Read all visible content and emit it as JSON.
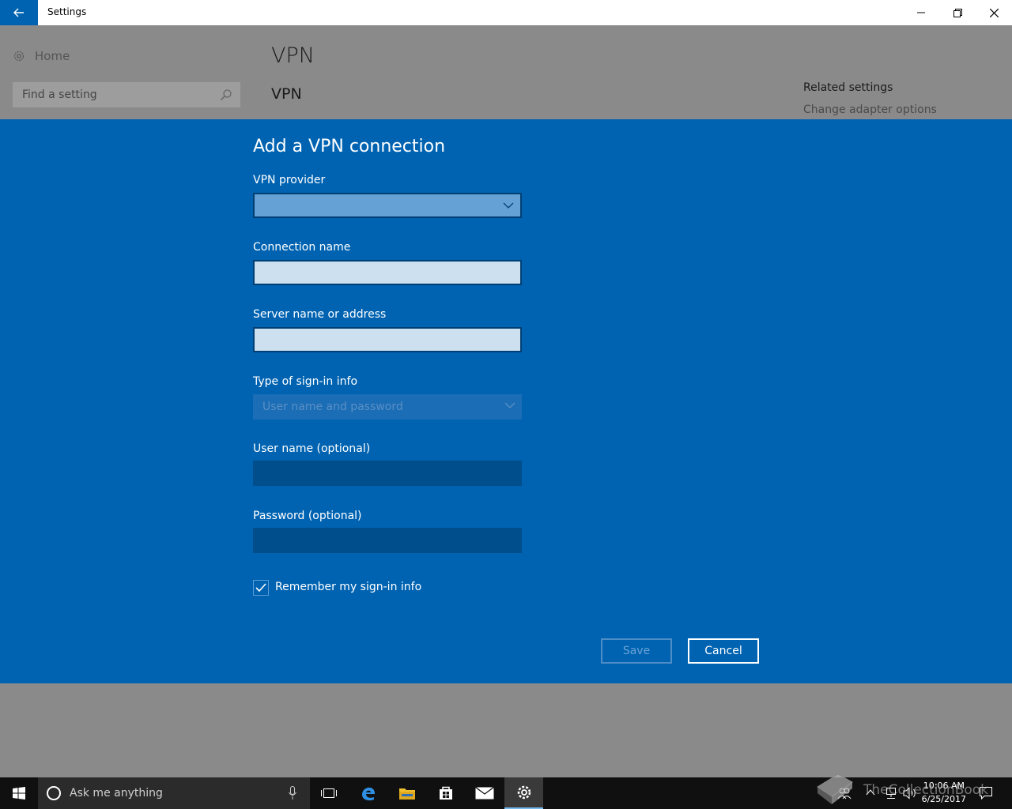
{
  "window": {
    "title": "Settings"
  },
  "sidebar": {
    "home_label": "Home",
    "search_placeholder": "Find a setting"
  },
  "main": {
    "page_title": "VPN",
    "section_title": "VPN",
    "related": {
      "title": "Related settings",
      "link": "Change adapter options"
    }
  },
  "dialog": {
    "title": "Add a VPN connection",
    "fields": {
      "provider_label": "VPN provider",
      "provider_value": "",
      "connection_name_label": "Connection name",
      "connection_name_value": "",
      "server_label": "Server name or address",
      "server_value": "",
      "signin_type_label": "Type of sign-in info",
      "signin_type_value": "User name and password",
      "username_label": "User name (optional)",
      "username_value": "",
      "password_label": "Password (optional)",
      "password_value": ""
    },
    "remember_label": "Remember my sign-in info",
    "remember_checked": true,
    "save_label": "Save",
    "cancel_label": "Cancel"
  },
  "taskbar": {
    "cortana_text": "Ask me anything",
    "time": "10:06 AM",
    "date": "6/25/2017"
  },
  "watermark": "TheCollectionBook",
  "colors": {
    "accent": "#0063b1",
    "taskbar": "#101010"
  }
}
